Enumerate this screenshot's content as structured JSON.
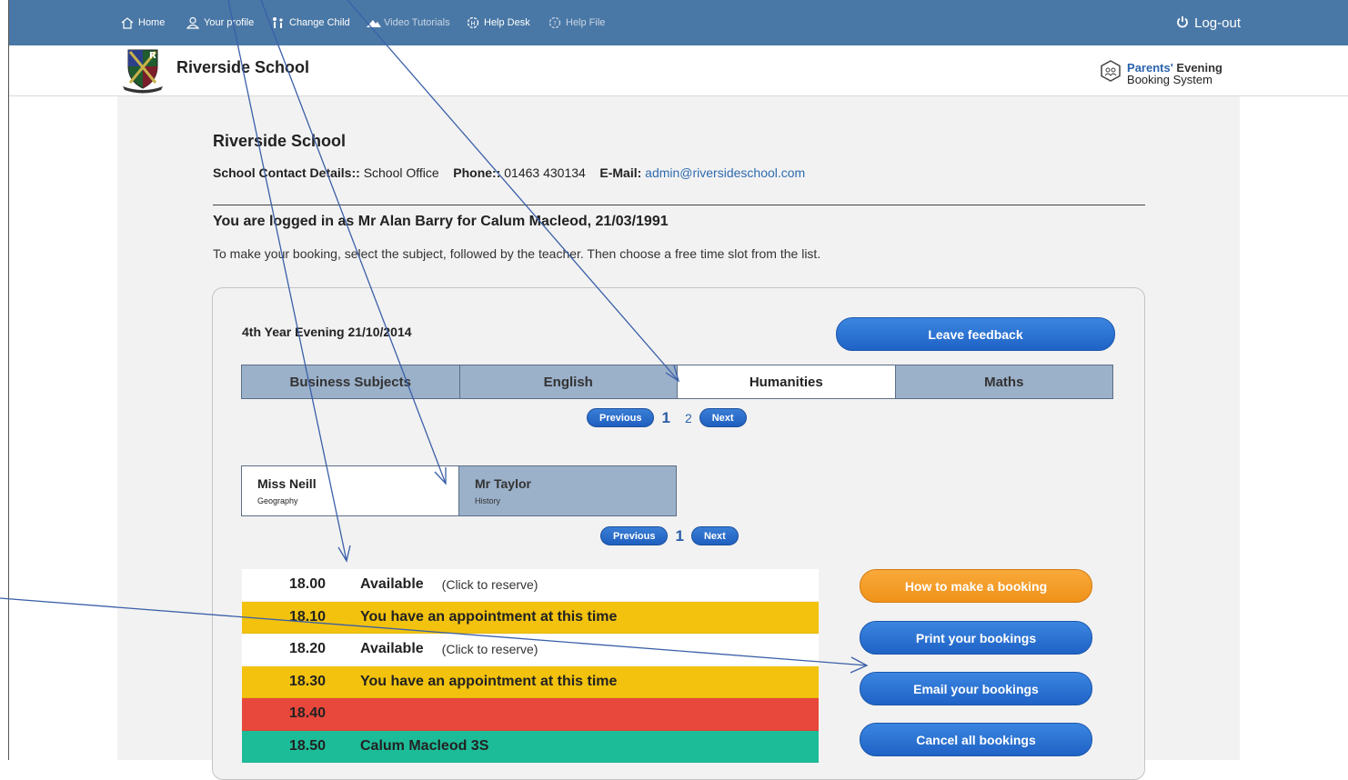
{
  "topbar": {
    "nav": [
      {
        "label": "Home",
        "icon": "home-icon"
      },
      {
        "label": "Your profile",
        "icon": "user-icon"
      },
      {
        "label": "Change Child",
        "icon": "change-child-icon"
      },
      {
        "label": "Video Tutorials",
        "icon": "video-icon"
      },
      {
        "label": "Help Desk",
        "icon": "help-desk-icon"
      },
      {
        "label": "Help File",
        "icon": "help-file-icon"
      }
    ],
    "logout_label": "Log-out",
    "logout_icon": "power-icon",
    "bar_color": "#4a78a6"
  },
  "header": {
    "school_name": "Riverside School",
    "product_line1_a": "Parents'",
    "product_line1_b": " Evening",
    "product_line2": "Booking System"
  },
  "school": {
    "title": "Riverside School",
    "contact_label": "School Contact Details::",
    "contact_value": "School Office",
    "phone_label": "Phone::",
    "phone_value": "01463 430134",
    "email_label": "E-Mail:",
    "email_value": "admin@riversideschool.com"
  },
  "session": {
    "logged_in_text": "You are logged in as Mr Alan Barry for Calum Macleod, 21/03/1991",
    "instructions": "To make your booking, select the subject, followed by the teacher. Then choose a free time slot from the list."
  },
  "evening": {
    "label": "4th Year Evening 21/10/2014",
    "feedback_label": "Leave feedback"
  },
  "subject_tabs": [
    {
      "label": "Business Subjects",
      "active": false
    },
    {
      "label": "English",
      "active": false
    },
    {
      "label": "Humanities",
      "active": true
    },
    {
      "label": "Maths",
      "active": false
    }
  ],
  "subject_pager": {
    "previous": "Previous",
    "pages": [
      "1",
      "2"
    ],
    "current": "1",
    "next": "Next"
  },
  "teacher_tabs": [
    {
      "name": "Miss Neill",
      "subject": "Geography",
      "active": true
    },
    {
      "name": "Mr Taylor",
      "subject": "History",
      "active": false
    }
  ],
  "teacher_pager": {
    "previous": "Previous",
    "pages": [
      "1"
    ],
    "current": "1",
    "next": "Next"
  },
  "slots": [
    {
      "time": "18.00",
      "status": "Available",
      "note": "(Click to reserve)",
      "state": "available"
    },
    {
      "time": "18.10",
      "status": "You have an appointment at this time",
      "note": "",
      "state": "appointment"
    },
    {
      "time": "18.20",
      "status": "Available",
      "note": "(Click to reserve)",
      "state": "available"
    },
    {
      "time": "18.30",
      "status": "You have an appointment at this time",
      "note": "",
      "state": "appointment"
    },
    {
      "time": "18.40",
      "status": "",
      "note": "",
      "state": "blocked"
    },
    {
      "time": "18.50",
      "status": "Calum Macleod 3S",
      "note": "",
      "state": "booked"
    }
  ],
  "actions": {
    "how_label": "How to make a booking",
    "print_label": "Print your bookings",
    "email_label": "Email your bookings",
    "cancel_label": "Cancel all bookings"
  },
  "colors": {
    "available": "#ffffff",
    "appointment": "#f2c20e",
    "blocked": "#e8473b",
    "booked": "#1dbc99",
    "accent_blue": "#1f63c6",
    "accent_orange": "#f0921a",
    "annotation_arrow": "#3a5fa8"
  }
}
